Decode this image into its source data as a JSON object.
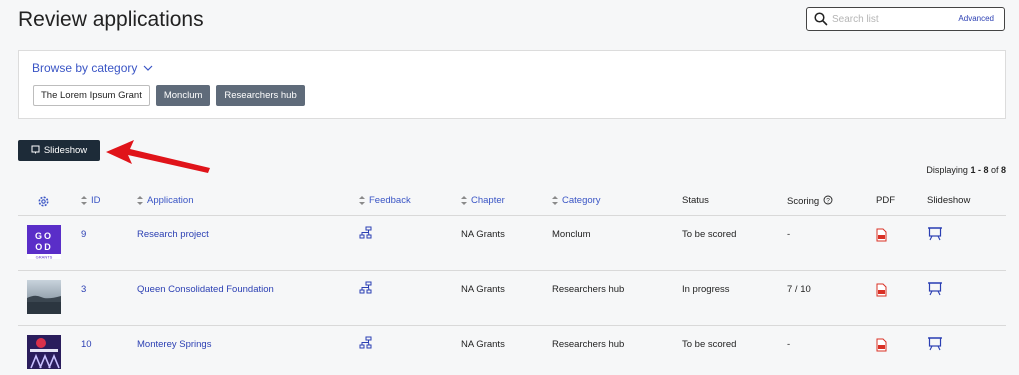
{
  "page": {
    "title": "Review applications"
  },
  "search": {
    "placeholder": "Search list",
    "advanced_label": "Advanced"
  },
  "browse": {
    "label": "Browse by category",
    "tags": [
      "The Lorem Ipsum Grant",
      "Monclum",
      "Researchers hub"
    ]
  },
  "toolbar": {
    "slideshow_label": "Slideshow"
  },
  "display": {
    "prefix": "Displaying ",
    "range": "1 - 8",
    "of": " of ",
    "total": "8"
  },
  "table": {
    "headers": {
      "id": "ID",
      "application": "Application",
      "feedback": "Feedback",
      "chapter": "Chapter",
      "category": "Category",
      "status": "Status",
      "scoring": "Scoring",
      "pdf": "PDF",
      "slideshow": "Slideshow"
    },
    "rows": [
      {
        "id": "9",
        "application": "Research project",
        "chapter": "NA Grants",
        "category": "Monclum",
        "status": "To be scored",
        "scoring": "-",
        "thumb_text": "GOOD GRANTS"
      },
      {
        "id": "3",
        "application": "Queen Consolidated Foundation",
        "chapter": "NA Grants",
        "category": "Researchers hub",
        "status": "In progress",
        "scoring": "7 / 10"
      },
      {
        "id": "10",
        "application": "Monterey Springs",
        "chapter": "NA Grants",
        "category": "Researchers hub",
        "status": "To be scored",
        "scoring": "-"
      }
    ]
  },
  "colors": {
    "link": "#2b3fb3",
    "accent": "#3a55c5",
    "button_dark": "#1d2b38",
    "tag_dark": "#5f6b7a",
    "pdf_red": "#d93025",
    "arrow_red": "#e0141a",
    "thumb_purple": "#5a2ec8"
  }
}
